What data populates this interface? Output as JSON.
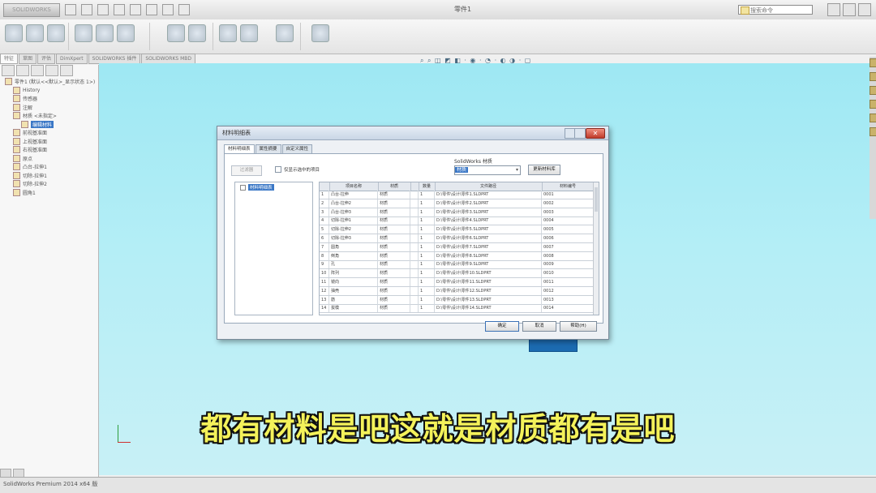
{
  "app": {
    "logo_text": "SOLIDWORKS",
    "search_placeholder": "搜索命令",
    "status_text": "SolidWorks Premium 2014 x64 版"
  },
  "ribbon": {
    "command_tabs": [
      "特征",
      "草图",
      "评估",
      "DimXpert",
      "SOLIDWORKS 插件",
      "SOLIDWORKS MBD"
    ]
  },
  "feature_tree": {
    "items": [
      {
        "label": "零件1 (默认<<默认>_显示状态 1>)",
        "depth": 0,
        "selected": false
      },
      {
        "label": "History",
        "depth": 1,
        "selected": false
      },
      {
        "label": "传感器",
        "depth": 1,
        "selected": false
      },
      {
        "label": "注解",
        "depth": 1,
        "selected": false
      },
      {
        "label": "材质 <未指定>",
        "depth": 1,
        "selected": false
      },
      {
        "label": "编辑材料",
        "depth": 2,
        "selected": true
      },
      {
        "label": "前视基准面",
        "depth": 1,
        "selected": false
      },
      {
        "label": "上视基准面",
        "depth": 1,
        "selected": false
      },
      {
        "label": "右视基准面",
        "depth": 1,
        "selected": false
      },
      {
        "label": "原点",
        "depth": 1,
        "selected": false
      },
      {
        "label": "凸台-拉伸1",
        "depth": 1,
        "selected": false
      },
      {
        "label": "切除-拉伸1",
        "depth": 1,
        "selected": false
      },
      {
        "label": "切除-拉伸2",
        "depth": 1,
        "selected": false
      },
      {
        "label": "圆角1",
        "depth": 1,
        "selected": false
      }
    ]
  },
  "dialog": {
    "title": "材料明细表",
    "close_glyph": "✕",
    "tabs": [
      "材料明细表",
      "属性摘要",
      "自定义属性"
    ],
    "filter_button": "过滤器",
    "checkbox_label": "仅显示选中的项目",
    "library_label": "SolidWorks 材质",
    "library_value": "材质",
    "library_button": "更新材料库",
    "tree_node": "材料明细表",
    "columns": [
      "项目名称",
      "材质",
      "",
      "数量",
      "文件路径",
      "材料编号"
    ],
    "rows": [
      [
        "1",
        "凸台-拉伸",
        "材质",
        "1",
        "D:\\零件\\设计\\零件1.SLDPRT",
        "0001"
      ],
      [
        "2",
        "凸台-拉伸2",
        "材质",
        "1",
        "D:\\零件\\设计\\零件2.SLDPRT",
        "0002"
      ],
      [
        "3",
        "凸台-拉伸3",
        "材质",
        "1",
        "D:\\零件\\设计\\零件3.SLDPRT",
        "0003"
      ],
      [
        "4",
        "切除-拉伸1",
        "材质",
        "1",
        "D:\\零件\\设计\\零件4.SLDPRT",
        "0004"
      ],
      [
        "5",
        "切除-拉伸2",
        "材质",
        "1",
        "D:\\零件\\设计\\零件5.SLDPRT",
        "0005"
      ],
      [
        "6",
        "切除-拉伸3",
        "材质",
        "1",
        "D:\\零件\\设计\\零件6.SLDPRT",
        "0006"
      ],
      [
        "7",
        "圆角",
        "材质",
        "1",
        "D:\\零件\\设计\\零件7.SLDPRT",
        "0007"
      ],
      [
        "8",
        "倒角",
        "材质",
        "1",
        "D:\\零件\\设计\\零件8.SLDPRT",
        "0008"
      ],
      [
        "9",
        "孔",
        "材质",
        "1",
        "D:\\零件\\设计\\零件9.SLDPRT",
        "0009"
      ],
      [
        "10",
        "阵列",
        "材质",
        "1",
        "D:\\零件\\设计\\零件10.SLDPRT",
        "0010"
      ],
      [
        "11",
        "镜向",
        "材质",
        "1",
        "D:\\零件\\设计\\零件11.SLDPRT",
        "0011"
      ],
      [
        "12",
        "抽壳",
        "材质",
        "1",
        "D:\\零件\\设计\\零件12.SLDPRT",
        "0012"
      ],
      [
        "13",
        "筋",
        "材质",
        "1",
        "D:\\零件\\设计\\零件13.SLDPRT",
        "0013"
      ],
      [
        "14",
        "拔模",
        "材质",
        "1",
        "D:\\零件\\设计\\零件14.SLDPRT",
        "0014"
      ]
    ],
    "ok_button": "确定",
    "cancel_button": "取消",
    "help_button": "帮助(H)"
  },
  "subtitle": "都有材料是吧这就是材质都有是吧",
  "colors": {
    "viewport": "#9ee8f3",
    "subtitle": "#f4f25a",
    "selection": "#3a77c6",
    "part": "#1c6bb1"
  }
}
